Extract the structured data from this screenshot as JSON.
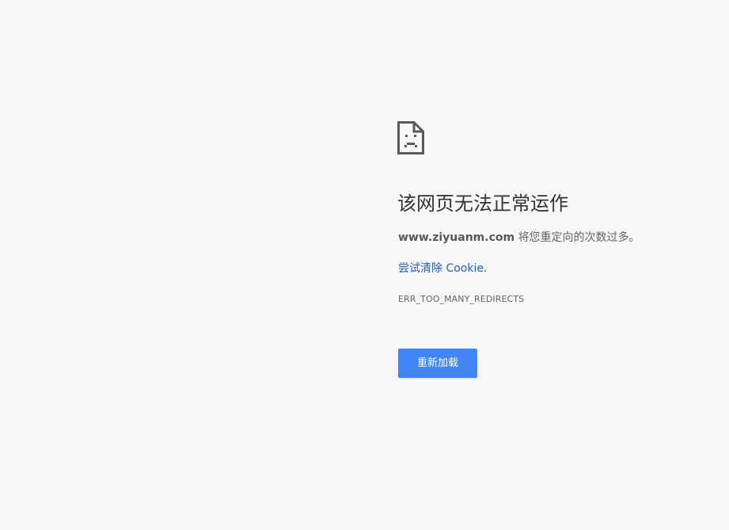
{
  "error_page": {
    "icon": "sad-page-icon",
    "heading": "该网页无法正常运作",
    "summary": {
      "host": "www.ziyuanm.com",
      "message": " 将您重定向的次数过多。"
    },
    "suggestion_link": "尝试清除 Cookie.",
    "error_code": "ERR_TOO_MANY_REDIRECTS",
    "reload_button_label": "重新加载"
  },
  "colors": {
    "background": "#f7f7f7",
    "heading": "#333333",
    "body_text": "#646464",
    "link": "#2a5db0",
    "button": "#4285f4",
    "button_text": "#ffffff"
  }
}
